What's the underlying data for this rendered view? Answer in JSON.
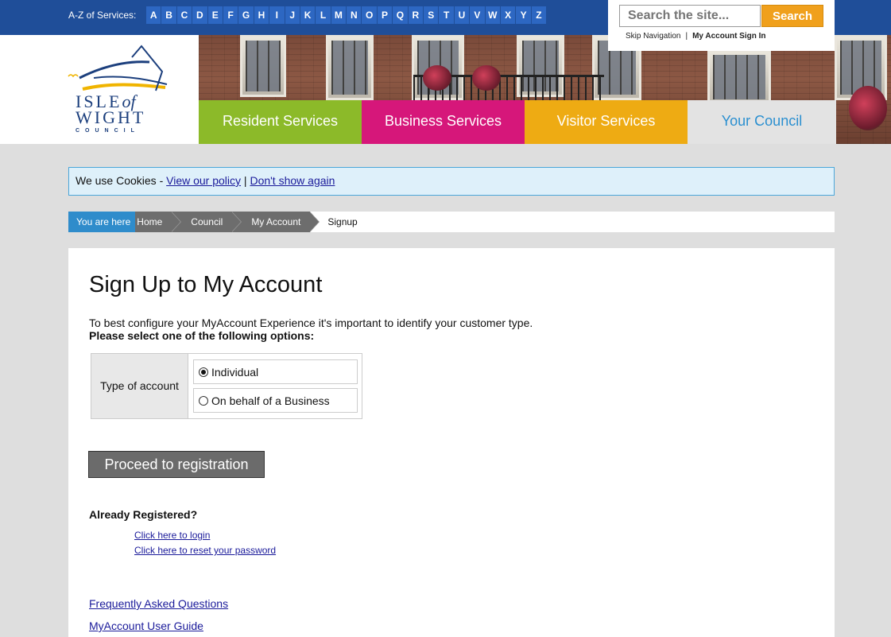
{
  "topbar": {
    "az_label": "A-Z of Services:",
    "letters": [
      "A",
      "B",
      "C",
      "D",
      "E",
      "F",
      "G",
      "H",
      "I",
      "J",
      "K",
      "L",
      "M",
      "N",
      "O",
      "P",
      "Q",
      "R",
      "S",
      "T",
      "U",
      "V",
      "W",
      "X",
      "Y",
      "Z"
    ]
  },
  "search": {
    "placeholder": "Search the site...",
    "button_label": "Search",
    "skip_nav": "Skip Navigation",
    "separator": "|",
    "sign_in": "My Account Sign In"
  },
  "logo": {
    "line1": "ISLE",
    "line1_of": "of",
    "line2": "WIGHT",
    "line3": "COUNCIL"
  },
  "nav": {
    "tabs": [
      {
        "label": "Resident Services",
        "color": "#8cba29"
      },
      {
        "label": "Business Services",
        "color": "#d6177a"
      },
      {
        "label": "Visitor Services",
        "color": "#eeab13"
      },
      {
        "label": "Your Council",
        "color": "#e3e3e3"
      }
    ]
  },
  "cookie": {
    "text": "We use Cookies - ",
    "policy_link": "View our policy",
    "sep": " | ",
    "dismiss_link": "Don't show again"
  },
  "breadcrumb": {
    "here_label": "You are here",
    "items": [
      "Home",
      "Council",
      "My Account"
    ],
    "current": "Signup"
  },
  "main": {
    "title": "Sign Up to My Account",
    "intro": "To best configure your MyAccount Experience it's important to identify your customer type.",
    "instruction": "Please select one of the following options:",
    "account_label": "Type of account",
    "options": [
      {
        "label": "Individual",
        "selected": true
      },
      {
        "label": "On behalf of a Business",
        "selected": false
      }
    ],
    "proceed_label": "Proceed to registration",
    "already_registered": "Already Registered?",
    "login_link": "Click here to login",
    "reset_link": "Click here to reset your password",
    "faq_link": "Frequently Asked Questions",
    "guide_link": "MyAccount User Guide"
  },
  "colors": {
    "topbar": "#1f4e99",
    "search_button": "#f0a01c",
    "breadcrumb_here": "#2f8ccb"
  }
}
